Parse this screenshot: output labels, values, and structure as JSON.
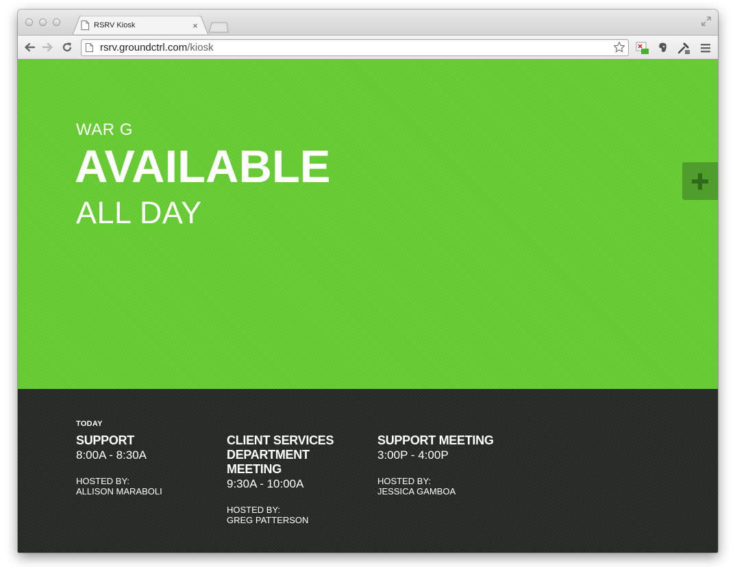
{
  "browser": {
    "tab_title": "RSRV Kiosk",
    "tab_close": "×",
    "url_host": "rsrv.groundctrl.com",
    "url_path": "/kiosk"
  },
  "room": {
    "name": "WAR G",
    "status": "AVAILABLE",
    "duration": "ALL DAY",
    "add_label": "+",
    "status_color": "#66cc33"
  },
  "schedule": {
    "heading": "TODAY",
    "meetings": [
      {
        "title": "SUPPORT",
        "time": "8:00A - 8:30A",
        "host_label": "HOSTED BY:",
        "host": "ALLISON MARABOLI"
      },
      {
        "title": "CLIENT SERVICES DEPARTMENT MEETING",
        "time": "9:30A - 10:00A",
        "host_label": "HOSTED BY:",
        "host": "GREG PATTERSON"
      },
      {
        "title": "SUPPORT MEETING",
        "time": "3:00P - 4:00P",
        "host_label": "HOSTED BY:",
        "host": "JESSICA GAMBOA"
      }
    ]
  }
}
